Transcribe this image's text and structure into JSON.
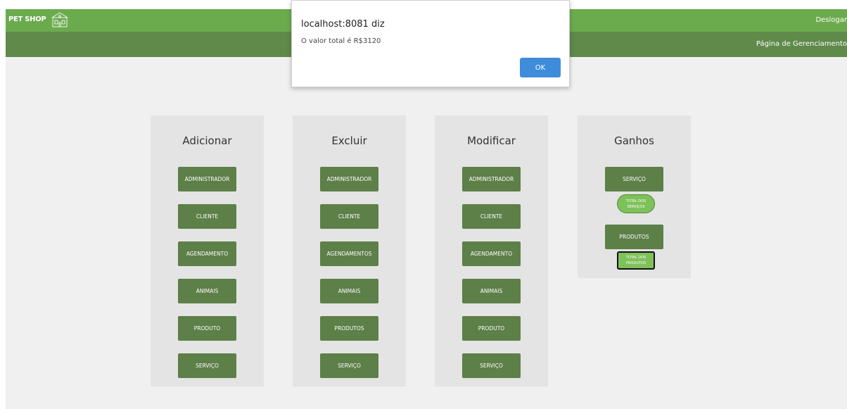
{
  "header": {
    "brand": "PET SHOP",
    "logout_label": "Deslogar",
    "page_label": "Página de Gerenciamento"
  },
  "panels": [
    {
      "title": "Adicionar",
      "buttons": [
        "ADMINISTRADOR",
        "CLIENTE",
        "AGENDAMENTO",
        "ANIMAIS",
        "PRODUTO",
        "SERVIÇO"
      ]
    },
    {
      "title": "Excluir",
      "buttons": [
        "ADMINISTRADOR",
        "CLIENTE",
        "AGENDAMENTOS",
        "ANIMAIS",
        "PRODUTOS",
        "SERVIÇO"
      ]
    },
    {
      "title": "Modificar",
      "buttons": [
        "ADMINISTRADOR",
        "CLIENTE",
        "AGENDAMENTO",
        "ANIMAIS",
        "PRODUTO",
        "SERVIÇO"
      ]
    },
    {
      "title": "Ganhos",
      "services_button": "SERVIÇO",
      "services_total": [
        "TOTAL DOS",
        "SERVIÇOS"
      ],
      "products_button": "PRODUTOS",
      "products_total": [
        "TOTAL DOS",
        "PRODUTOS"
      ]
    }
  ],
  "dialog": {
    "title": "localhost:8081 diz",
    "message": "O valor total é R$3120",
    "ok_label": "OK"
  },
  "colors": {
    "header": "#6bab4e",
    "subheader": "#5f8a4a",
    "button": "#5d7f48",
    "pill": "#7ec15a",
    "dialog_ok": "#3f8cdb"
  }
}
